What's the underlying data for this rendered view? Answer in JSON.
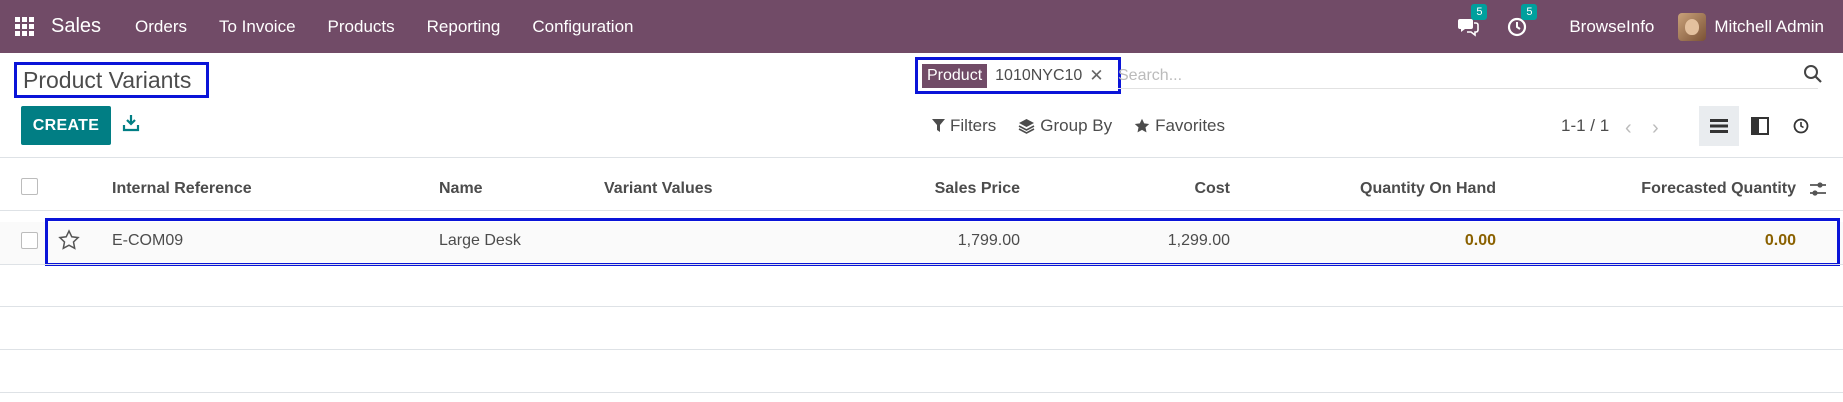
{
  "navbar": {
    "app_name": "Sales",
    "menu": [
      "Orders",
      "To Invoice",
      "Products",
      "Reporting",
      "Configuration"
    ],
    "messages_count": "5",
    "activities_count": "5",
    "company": "BrowseInfo",
    "user": "Mitchell Admin",
    "bg_color": "#714b67"
  },
  "control_panel": {
    "title": "Product Variants",
    "create_label": "CREATE",
    "search": {
      "facet_label": "Product",
      "facet_value": "1010NYC10",
      "placeholder": "Search..."
    },
    "filters_label": "Filters",
    "group_by_label": "Group By",
    "favorites_label": "Favorites",
    "pager": "1-1 / 1",
    "accent_color": "#017e84"
  },
  "table": {
    "columns": [
      "Internal Reference",
      "Name",
      "Variant Values",
      "Sales Price",
      "Cost",
      "Quantity On Hand",
      "Forecasted Quantity"
    ],
    "rows": [
      {
        "internal_reference": "E-COM09",
        "name": "Large Desk",
        "variant_values": "",
        "sales_price": "1,799.00",
        "cost": "1,299.00",
        "qty_on_hand": "0.00",
        "forecasted_qty": "0.00"
      }
    ]
  }
}
